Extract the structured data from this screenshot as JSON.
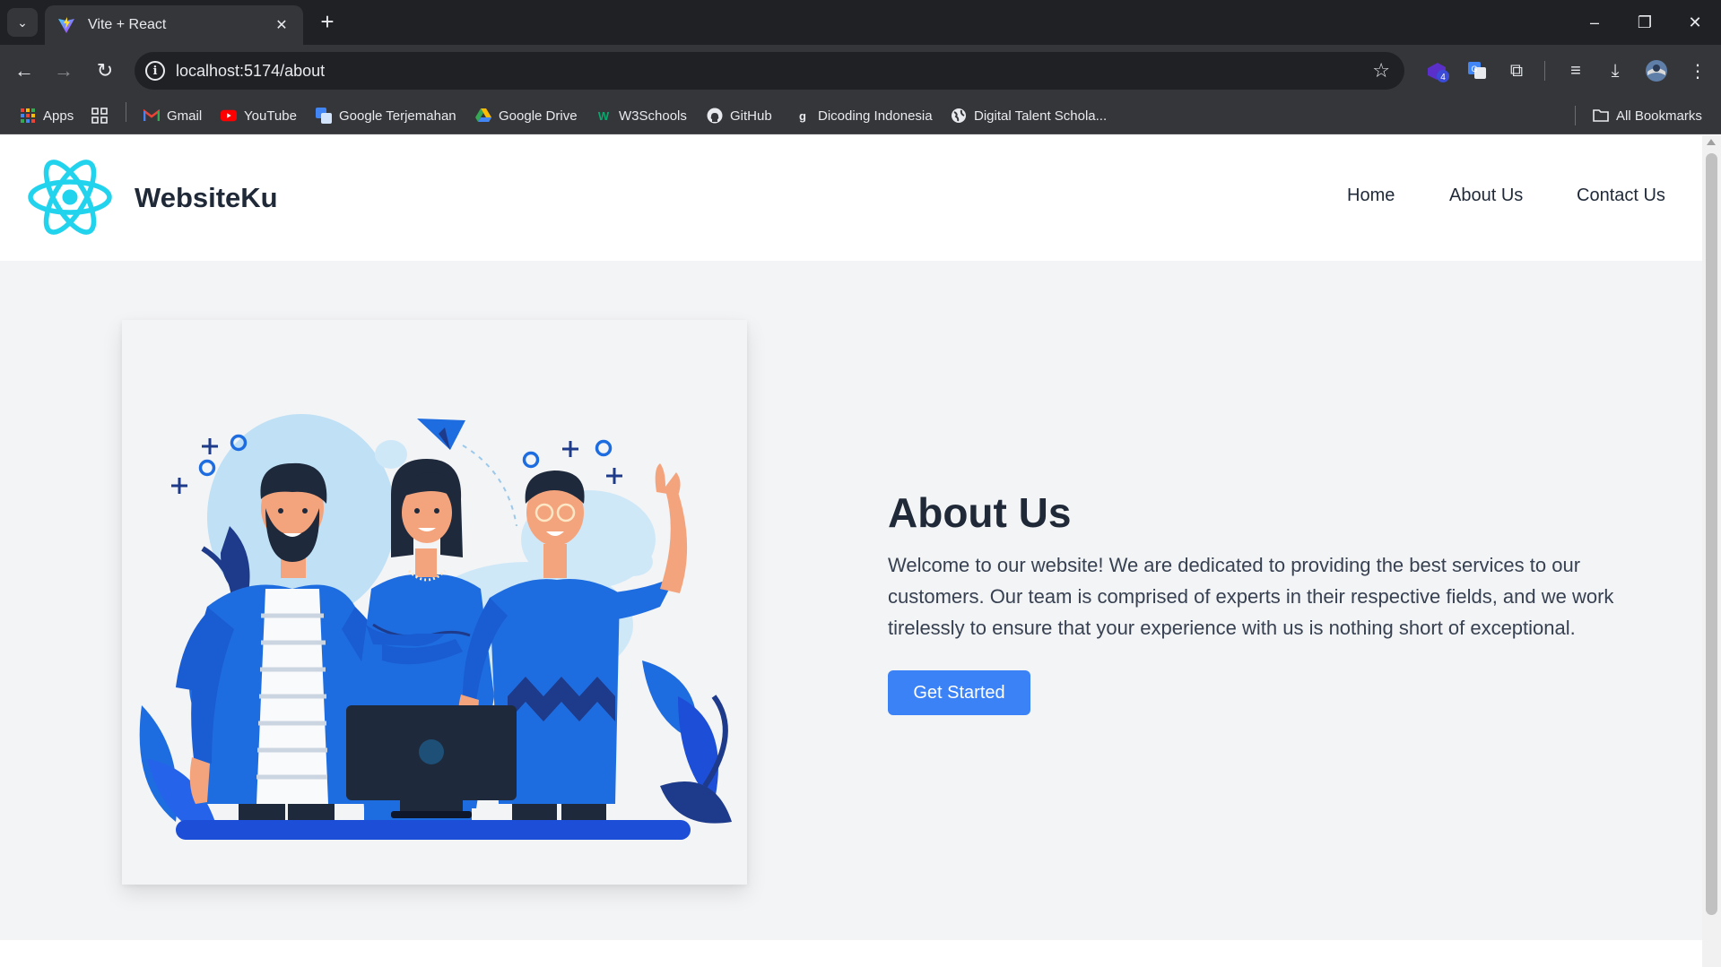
{
  "browser": {
    "tab_title": "Vite + React",
    "url": "localhost:5174/about",
    "bookmarks": [
      {
        "label": "Apps",
        "icon": "apps-grid-icon"
      },
      {
        "label": "Gmail",
        "icon": "gmail-icon"
      },
      {
        "label": "YouTube",
        "icon": "youtube-icon"
      },
      {
        "label": "Google Terjemahan",
        "icon": "translate-icon"
      },
      {
        "label": "Google Drive",
        "icon": "drive-icon"
      },
      {
        "label": "W3Schools",
        "icon": "w3schools-icon"
      },
      {
        "label": "GitHub",
        "icon": "github-icon"
      },
      {
        "label": "Dicoding Indonesia",
        "icon": "dicoding-icon"
      },
      {
        "label": "Digital Talent Schola...",
        "icon": "globe-icon"
      }
    ],
    "all_bookmarks_label": "All Bookmarks",
    "extension_badge": "4"
  },
  "site": {
    "brand": "WebsiteKu",
    "nav": [
      "Home",
      "About Us",
      "Contact Us"
    ]
  },
  "about": {
    "title": "About Us",
    "text": "Welcome to our website! We are dedicated to providing the best services to our customers. Our team is comprised of experts in their respective fields, and we work tirelessly to ensure that your experience with us is nothing short of exceptional.",
    "cta_label": "Get Started"
  },
  "colors": {
    "accent": "#3b82f6",
    "react_logo": "#22d3ee",
    "page_bg": "#f3f4f6",
    "text_dark": "#1f2937"
  }
}
